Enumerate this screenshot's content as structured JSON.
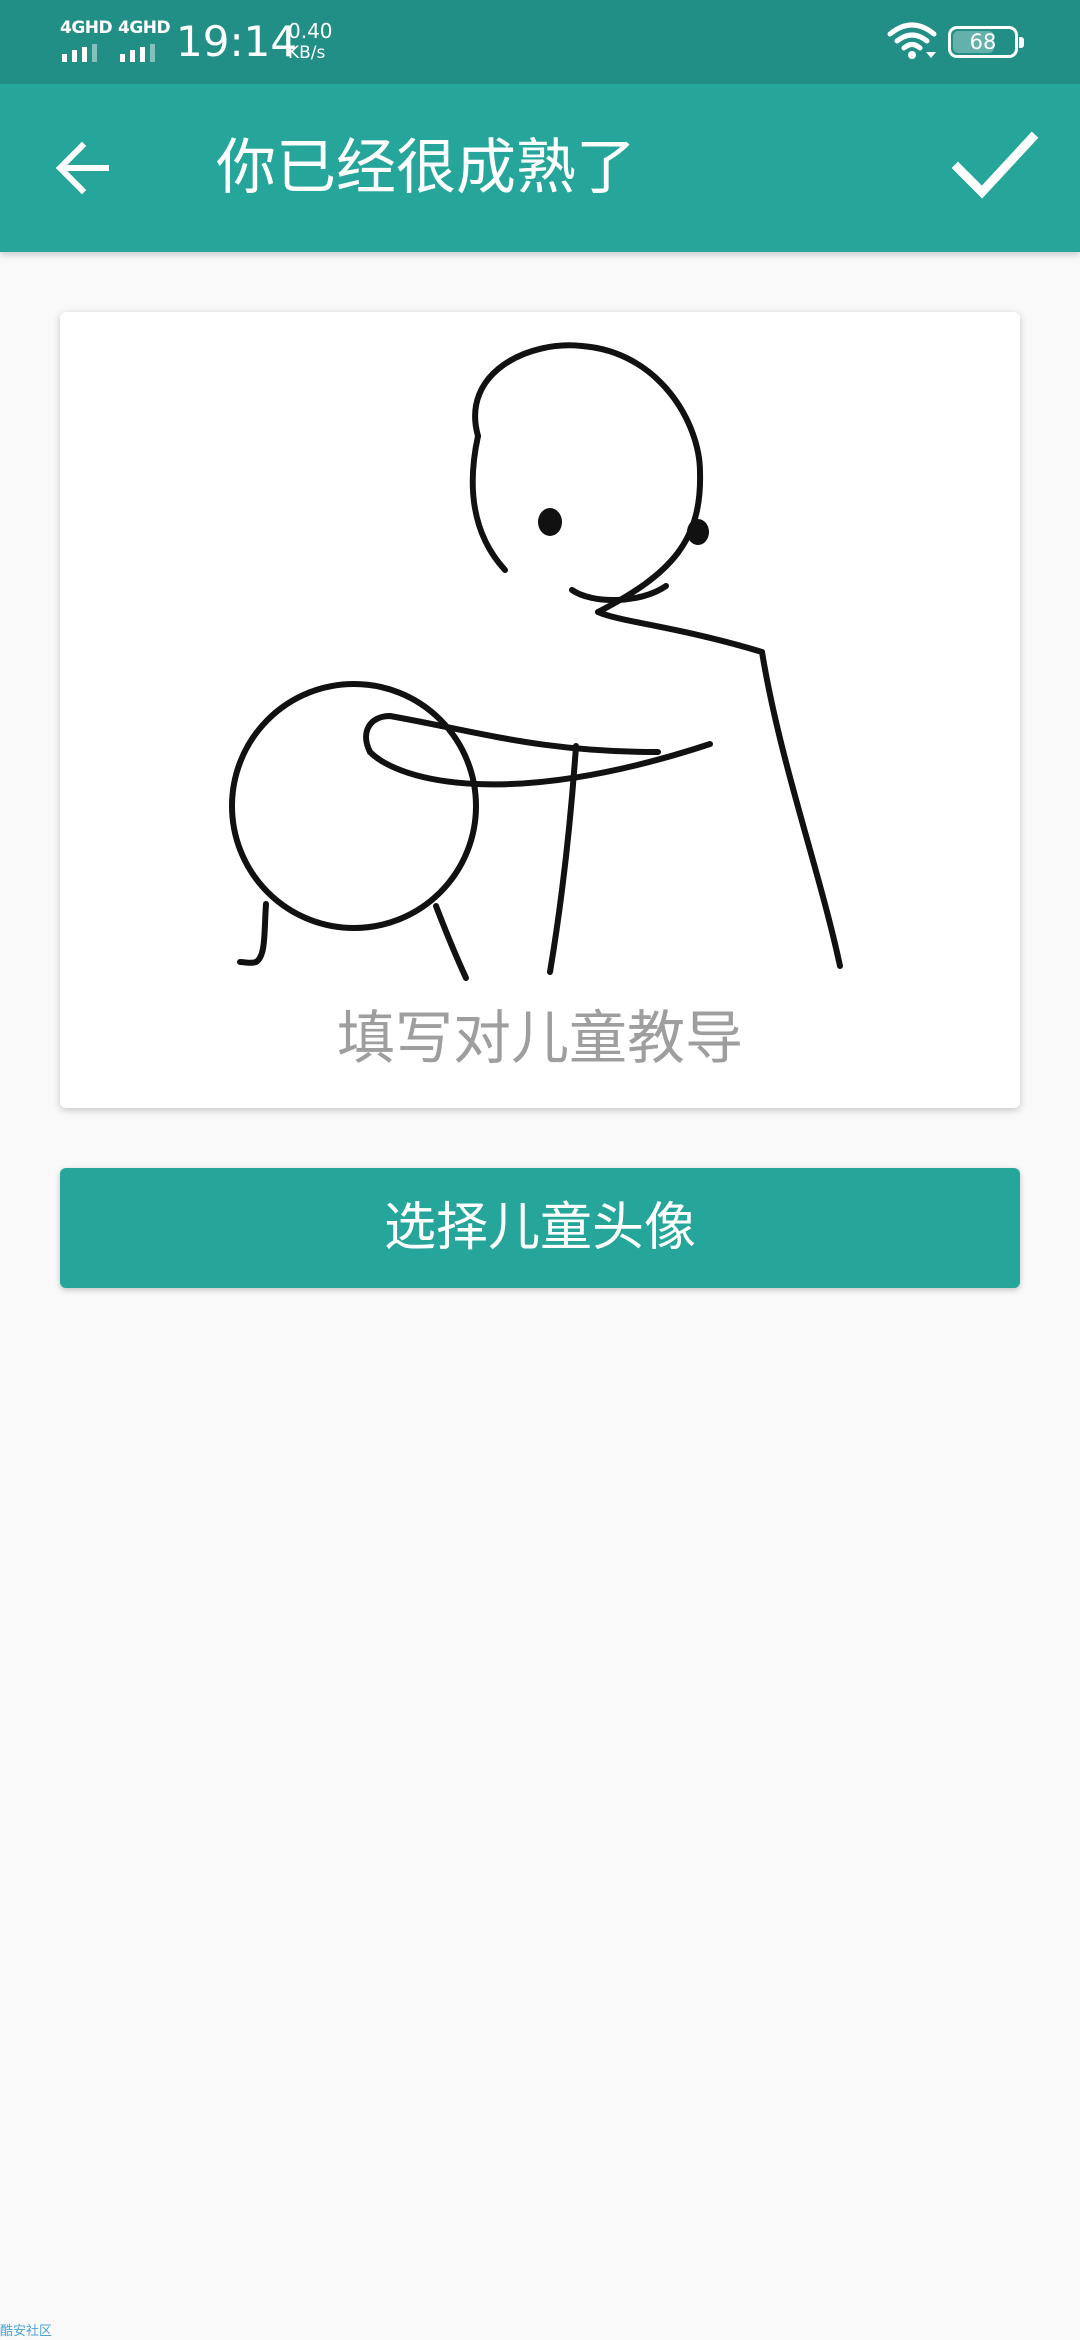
{
  "status_bar": {
    "sim1_network": "4GHD",
    "sim2_network": "4GHD",
    "time": "19:14",
    "net_speed_value": "0.40",
    "net_speed_unit": "KB/s",
    "battery_level": "68",
    "icons": [
      "signal-icon",
      "wifi-icon",
      "battery-icon"
    ]
  },
  "app_bar": {
    "title": "你已经很成熟了",
    "back_icon": "arrow-left-icon",
    "confirm_icon": "check-icon",
    "background_color": "#26a69a"
  },
  "card": {
    "image": "stick-figure-pushing-circle-drawing",
    "caption": "填写对儿童教导"
  },
  "primary_button": {
    "label": "选择儿童头像",
    "color": "#26a69a"
  },
  "watermark": "酷安社区"
}
